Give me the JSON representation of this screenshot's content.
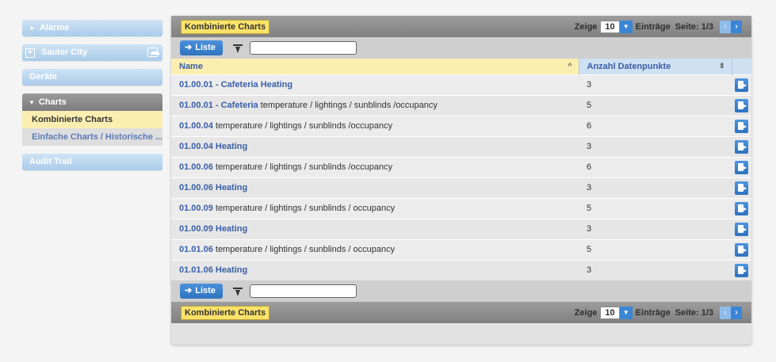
{
  "sidebar": {
    "alarme": "Alarme",
    "city": "Sauter City",
    "geraete": "Geräte",
    "charts_head": "Charts",
    "charts_items": [
      "Kombinierte Charts",
      "Einfache Charts / Historische ..."
    ],
    "audit": "Audit Trail"
  },
  "header": {
    "title": "Kombinierte Charts",
    "show_label": "Zeige",
    "page_size": "10",
    "entries_label": "Einträge",
    "page_label": "Seite: 1/3"
  },
  "toolbar": {
    "liste_label": "Liste",
    "search_value": ""
  },
  "table": {
    "col_name": "Name",
    "col_count": "Anzahl Datenpunkte",
    "rows": [
      {
        "id": "01.00.01 - Cafeteria Heating",
        "rest": "",
        "count": "3"
      },
      {
        "id": "01.00.01 - Cafeteria",
        "rest": " temperature / lightings / sunblinds /occupancy",
        "count": "5"
      },
      {
        "id": "01.00.04",
        "rest": " temperature / lightings / sunblinds /occupancy",
        "count": "6"
      },
      {
        "id": "01.00.04 Heating",
        "rest": "",
        "count": "3"
      },
      {
        "id": "01.00.06",
        "rest": " temperature / lightings / sunblinds /occupancy",
        "count": "6"
      },
      {
        "id": "01.00.06 Heating",
        "rest": "",
        "count": "3"
      },
      {
        "id": "01.00.09",
        "rest": " temperature / lightings / sunblinds / occupancy",
        "count": "5"
      },
      {
        "id": "01.00.09 Heating",
        "rest": "",
        "count": "3"
      },
      {
        "id": "01.01.06",
        "rest": " temperature / lightings / sunblinds / occupancy",
        "count": "5"
      },
      {
        "id": "01.01.06 Heating",
        "rest": "",
        "count": "3"
      }
    ]
  },
  "footer": {
    "title": "Kombinierte Charts",
    "show_label": "Zeige",
    "page_size": "10",
    "entries_label": "Einträge",
    "page_label": "Seite: 1/3"
  }
}
